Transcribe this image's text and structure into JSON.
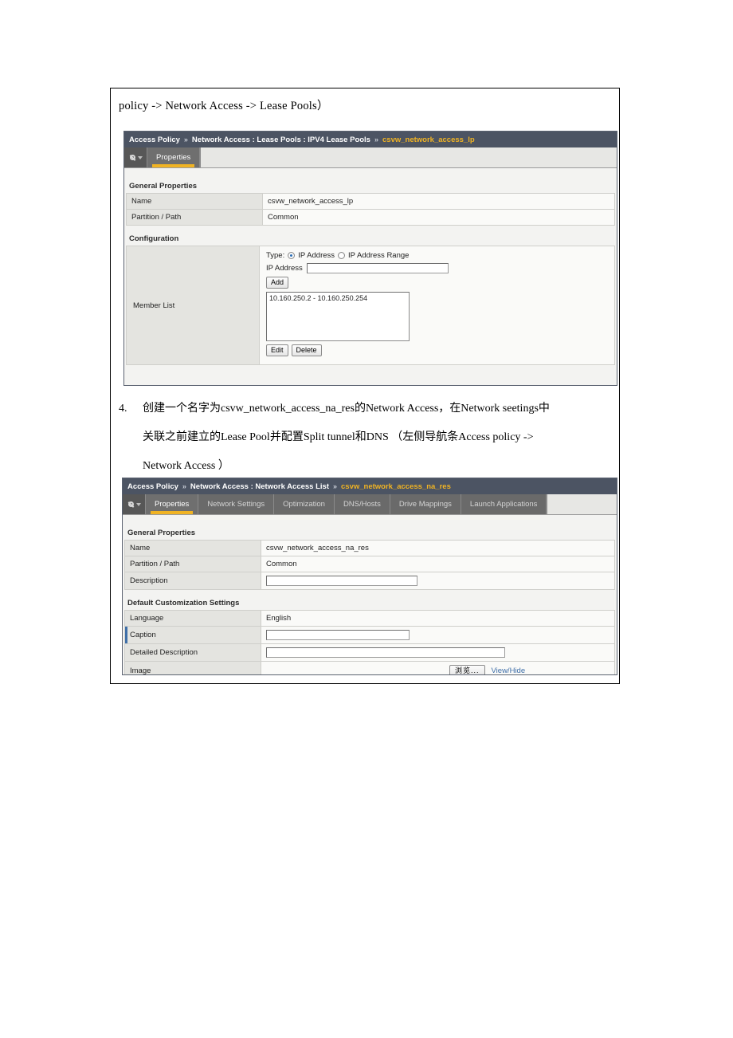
{
  "document": {
    "intro_line": "policy -> Network Access -> Lease Pools）",
    "step": {
      "number": "4.",
      "line1": "创建一个名字为csvw_network_access_na_res的Network Access，在Network seetings中",
      "line2": "关联之前建立的Lease Pool并配置Split tunnel和DNS （左侧导航条Access policy ->",
      "line3": "Network Access ）"
    }
  },
  "panel_lease_pools": {
    "breadcrumb": {
      "root": "Access Policy",
      "sep1": "»",
      "path": "Network Access : Lease Pools : IPV4 Lease Pools",
      "sep2": "»",
      "current": "csvw_network_access_lp"
    },
    "tabs": [
      {
        "label": "Properties",
        "active": true
      }
    ],
    "sections": {
      "general_properties": "General Properties",
      "configuration": "Configuration"
    },
    "rows": {
      "name_label": "Name",
      "name_value": "csvw_network_access_lp",
      "partition_label": "Partition / Path",
      "partition_value": "Common",
      "member_list_label": "Member List"
    },
    "member_list": {
      "type_label": "Type:",
      "type_option_ip": "IP Address",
      "type_option_range": "IP Address Range",
      "type_selected": "IP Address",
      "ip_address_label": "IP Address",
      "ip_address_value": "",
      "add_button": "Add",
      "entries": [
        "10.160.250.2 - 10.160.250.254"
      ],
      "edit_button": "Edit",
      "delete_button": "Delete"
    }
  },
  "panel_network_access": {
    "breadcrumb": {
      "root": "Access Policy",
      "sep1": "»",
      "path": "Network Access : Network Access List",
      "sep2": "»",
      "current": "csvw_network_access_na_res"
    },
    "tabs": [
      {
        "label": "Properties",
        "active": true
      },
      {
        "label": "Network Settings",
        "active": false
      },
      {
        "label": "Optimization",
        "active": false
      },
      {
        "label": "DNS/Hosts",
        "active": false
      },
      {
        "label": "Drive Mappings",
        "active": false
      },
      {
        "label": "Launch Applications",
        "active": false
      }
    ],
    "sections": {
      "general_properties": "General Properties",
      "default_customization": "Default Customization Settings"
    },
    "rows": {
      "name_label": "Name",
      "name_value": "csvw_network_access_na_res",
      "partition_label": "Partition / Path",
      "partition_value": "Common",
      "description_label": "Description",
      "description_value": "",
      "language_label": "Language",
      "language_value": "English",
      "caption_label": "Caption",
      "caption_value": "",
      "detailed_description_label": "Detailed Description",
      "detailed_description_value": "",
      "image_label": "Image",
      "image_browse_button": "浏览...",
      "image_view_hide_link": "View/Hide"
    }
  },
  "colors": {
    "breadcrumb_bg": "#4c5463",
    "breadcrumb_current": "#f0b323",
    "tab_bg": "#6a6a6a",
    "tab_active_underline": "#f0b323",
    "panel_bg": "#f3f3f1",
    "label_cell_bg": "#e4e4e0",
    "row_marker": "#3f6fa8",
    "link": "#3e6ea8"
  }
}
